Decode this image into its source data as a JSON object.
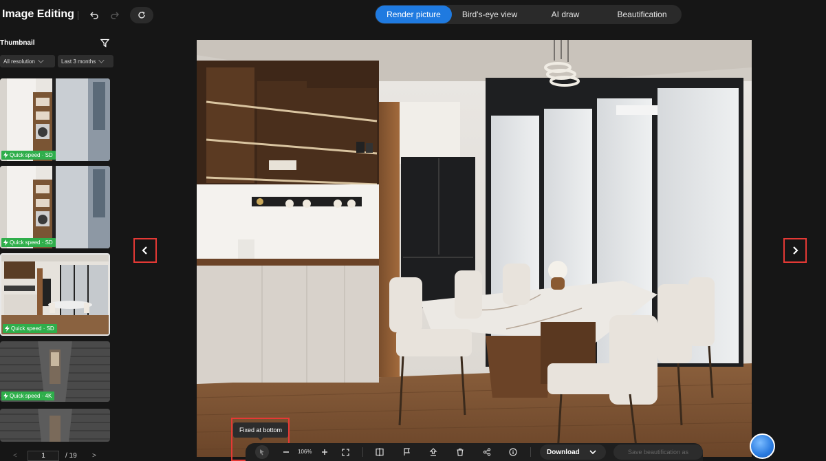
{
  "header": {
    "title": "Image Editing",
    "tabs": [
      {
        "label": "Render picture",
        "active": true
      },
      {
        "label": "Bird's-eye view",
        "active": false
      },
      {
        "label": "AI draw",
        "active": false
      },
      {
        "label": "Beautification",
        "active": false
      }
    ]
  },
  "sidebar": {
    "title": "Thumbnail",
    "resolution_filter": "All resolution",
    "time_filter": "Last 3 months",
    "thumbnails": [
      {
        "badge": "Quick speed · SD",
        "scene": "laundry"
      },
      {
        "badge": "Quick speed · SD",
        "scene": "laundry"
      },
      {
        "badge": "Quick speed · SD",
        "scene": "dining",
        "selected": true
      },
      {
        "badge": "Quick speed · 4K",
        "scene": "brick"
      },
      {
        "badge": "",
        "scene": "brick"
      }
    ],
    "pager": {
      "prev": "<",
      "current": "1",
      "total": "/ 19",
      "next": ">"
    }
  },
  "toolbar": {
    "tooltip": "Fixed at bottom",
    "zoom": "106%",
    "download_label": "Download",
    "save_label": "Save beautification as"
  },
  "colors": {
    "accent": "#1f7ae0",
    "badge_green": "#2fae4b",
    "highlight_red": "#e53935",
    "background": "#161616"
  }
}
